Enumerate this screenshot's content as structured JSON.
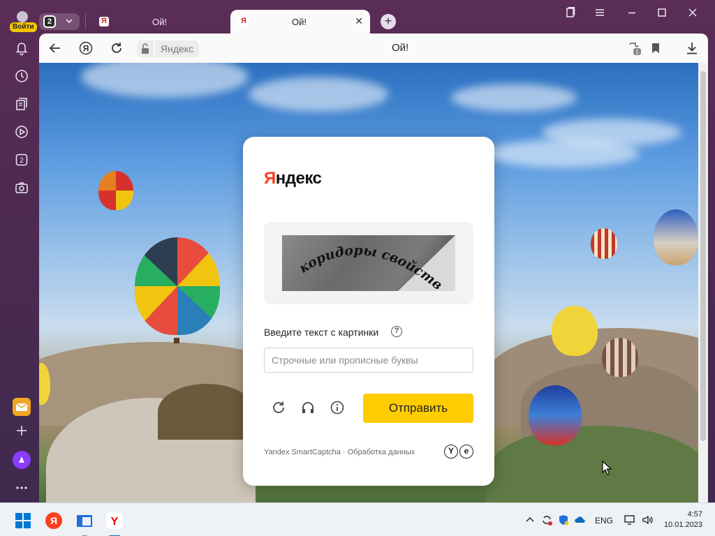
{
  "browser": {
    "profile": {
      "login_label": "Войти"
    },
    "tab_count": "2",
    "tabs": [
      {
        "title": "Ой!",
        "favicon": "yandex-favicon"
      },
      {
        "title": "Ой!",
        "favicon": "yandex-favicon",
        "active": true
      }
    ],
    "address": {
      "domain": "Яндекс",
      "page_title": "Ой!"
    },
    "sidebar": {
      "tabs_badge": "2"
    },
    "toolbar_icons": [
      "back-arrow-icon",
      "yandex-logo-icon",
      "reload-icon",
      "lock-icon",
      "extensions-icon",
      "bookmark-icon",
      "download-icon"
    ],
    "extensions_badge": "1",
    "window_controls": [
      "collections-icon",
      "menu-icon",
      "minimize-icon",
      "maximize-icon",
      "close-icon"
    ]
  },
  "captcha": {
    "logo": {
      "first": "Я",
      "rest": "ндекс"
    },
    "captcha_text": "коридоры свойства",
    "prompt": "Введите текст с картинки",
    "help": "?",
    "input": {
      "value": "",
      "placeholder": "Строчные или прописные буквы"
    },
    "controls": [
      "refresh-icon",
      "audio-icon",
      "info-icon"
    ],
    "submit_label": "Отправить",
    "footer": "Yandex SmartCaptcha · Обработка данных",
    "footer_logos": [
      "Y",
      "e"
    ]
  },
  "taskbar": {
    "apps": [
      "windows-start-icon",
      "yandex-browser-icon",
      "file-explorer-icon",
      "yandex-app-icon"
    ],
    "language": "ENG",
    "time": "4:57",
    "date": "10.01.2023"
  },
  "colors": {
    "chrome": "#4e2a52",
    "submit": "#ffcc00",
    "logo_red": "#fc3f1d",
    "taskbar": "#eef1f6"
  }
}
